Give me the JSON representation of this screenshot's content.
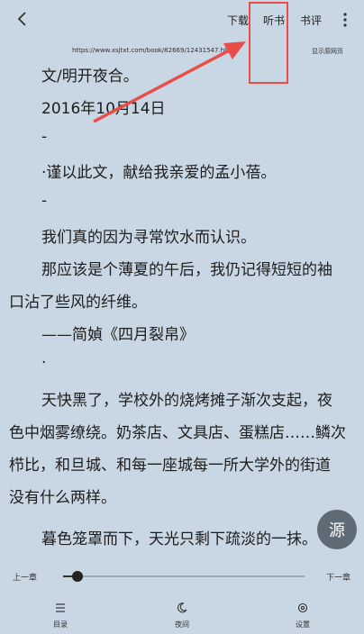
{
  "toolbar": {
    "download_label": "下载",
    "listen_label": "听书",
    "review_label": "书评"
  },
  "page": {
    "url": "https://www.xsjtxt.com/book/82669/12431547.html",
    "web_view_label": "显示原网页"
  },
  "content": {
    "lines": [
      "文/明开夜合。",
      "2016年10月14日",
      "-",
      "·谨以此文，献给我亲爱的孟小蓓。",
      "-",
      "我们真的因为寻常饮水而认识。",
      "那应该是个薄夏的午后，我仍记得短短的袖",
      "口沾了些风的纤维。",
      "——简媜《四月裂帛》",
      "·",
      "天快黑了，学校外的烧烤摊子渐次支起，夜",
      "色中烟雾缭绕。奶茶店、文具店、蛋糕店……鳞次",
      "栉比，和旦城、和每一座城每一所大学外的街道",
      "没有什么两样。",
      "暮色笼罩而下，天光只剩下疏淡的一抹。"
    ]
  },
  "fab": {
    "label": "源"
  },
  "progress": {
    "prev_label": "上一章",
    "next_label": "下一章",
    "value": 0.06
  },
  "bottom_nav": {
    "toc_label": "目录",
    "night_label": "夜间",
    "settings_label": "设置"
  }
}
